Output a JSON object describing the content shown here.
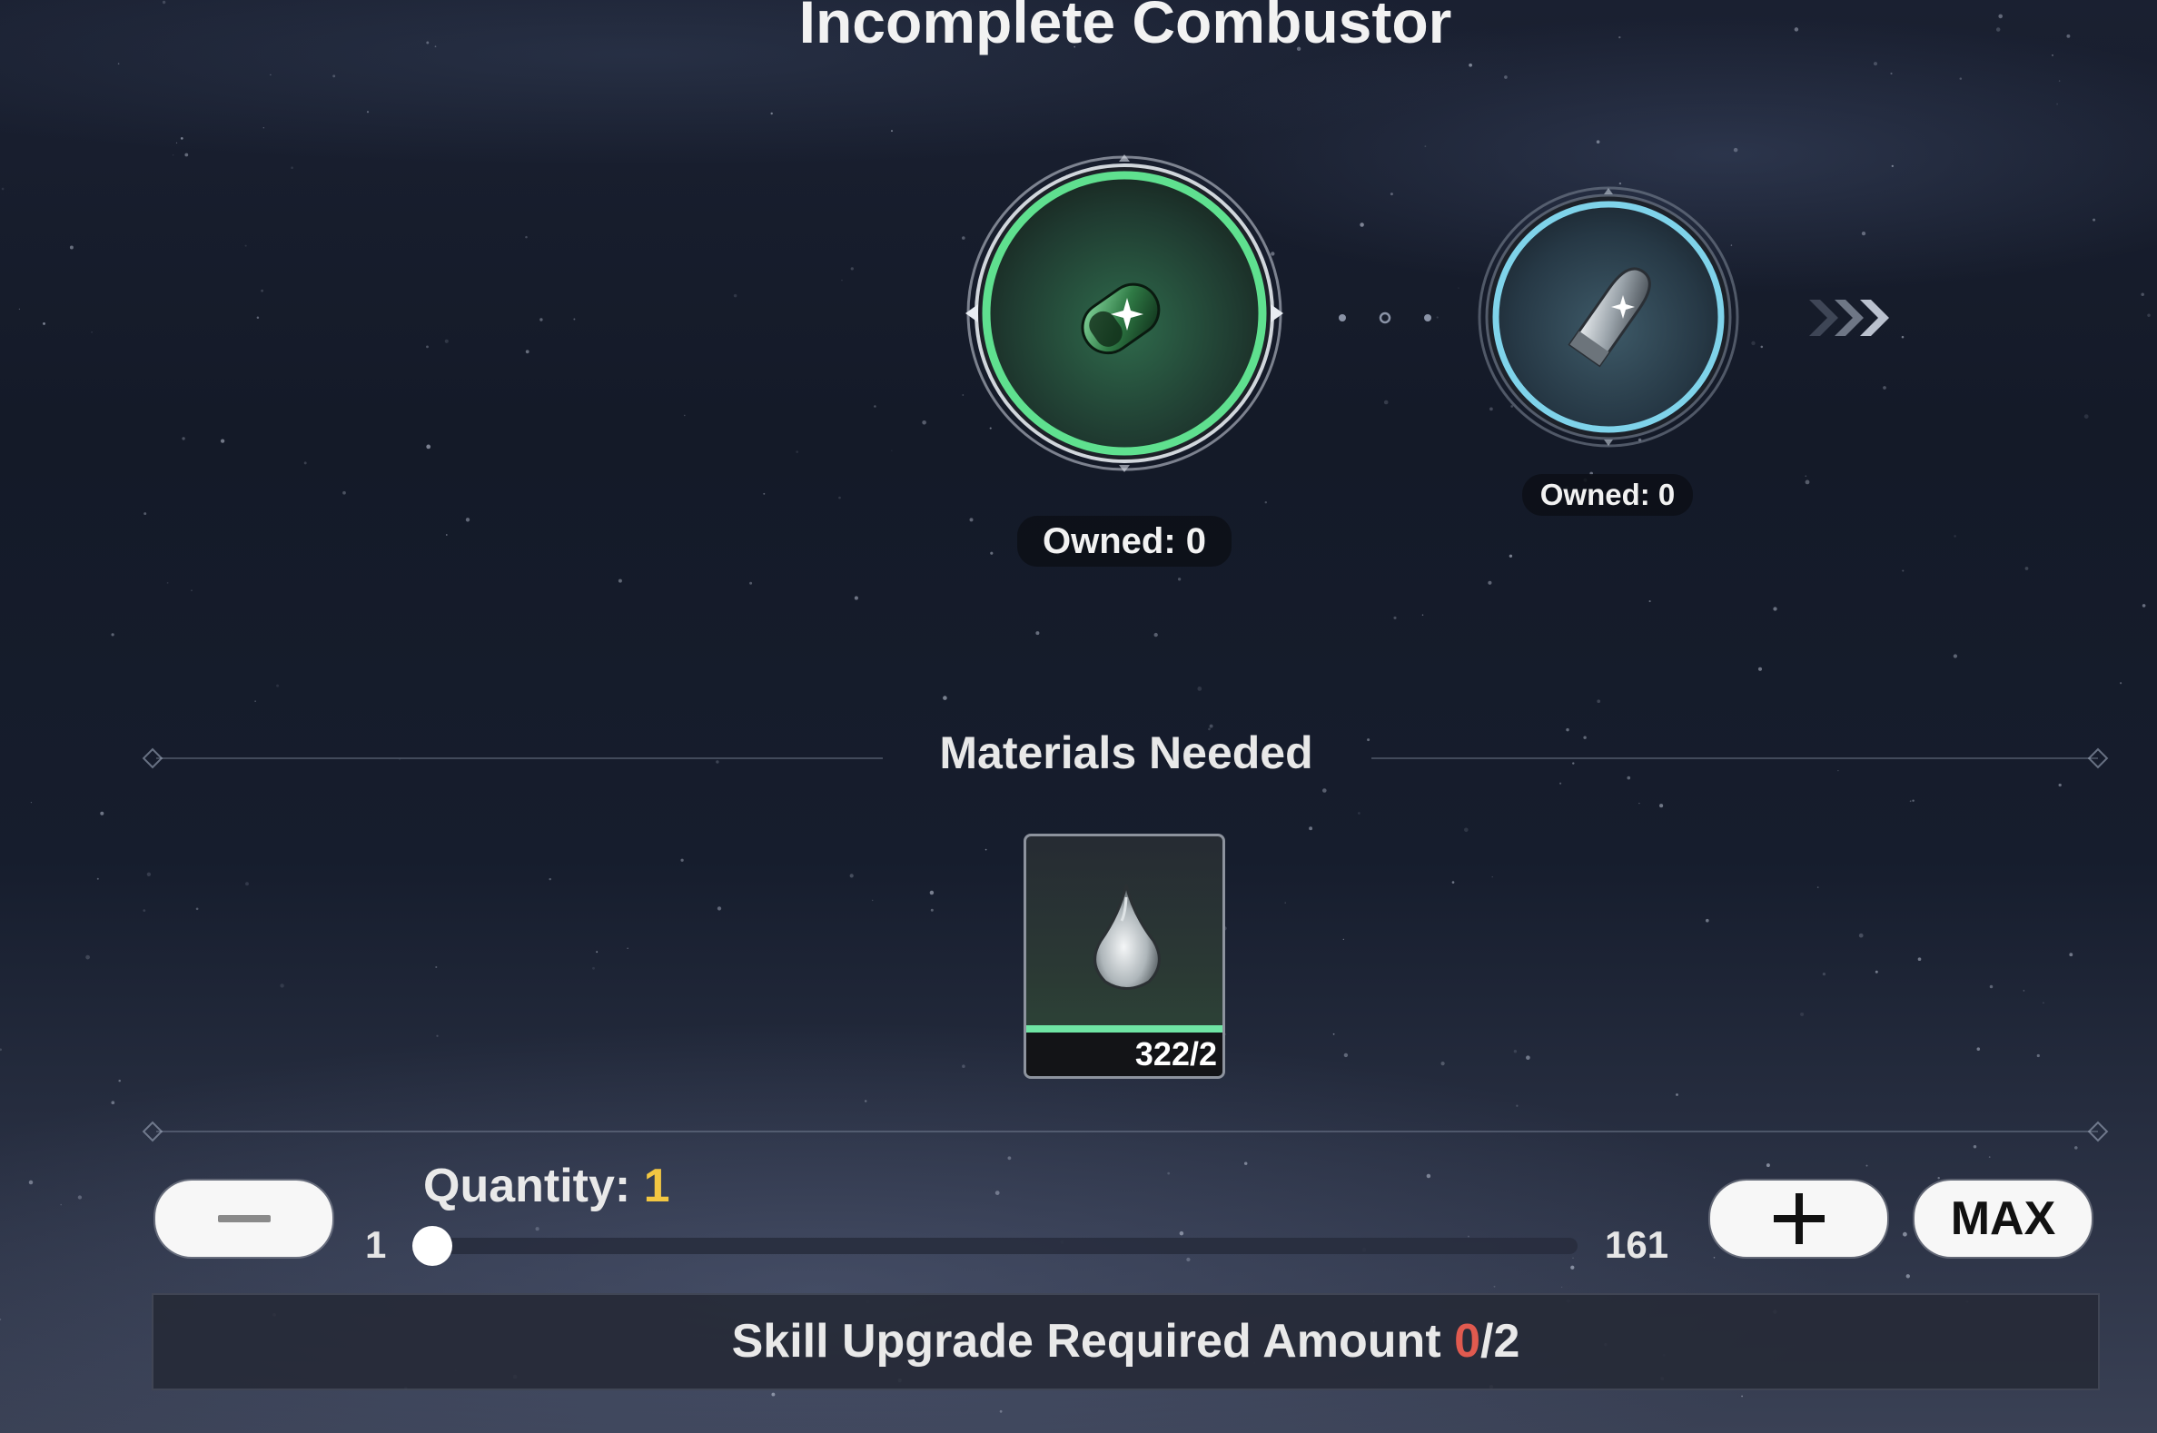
{
  "header": {
    "title": "Incomplete Combustor"
  },
  "upgrade_path": {
    "nodes": [
      {
        "owned_label": "Owned: 0",
        "icon": "green-crystal-shell-icon",
        "rarity_color": "#5fe08f"
      },
      {
        "owned_label": "Owned: 0",
        "icon": "blue-metal-bullet-icon",
        "rarity_color": "#7fd3ea"
      }
    ],
    "next_icon": "chevron-right-triple-icon"
  },
  "materials": {
    "title": "Materials Needed",
    "items": [
      {
        "icon": "clear-droplet-icon",
        "count_label": "322/2",
        "bar_color": "#6fe5a4"
      }
    ]
  },
  "quantity": {
    "label": "Quantity: ",
    "value": "1",
    "min": "1",
    "max": "161",
    "minus_icon": "minus-icon",
    "plus_icon": "plus-icon",
    "max_label": "MAX",
    "slider_fraction": 0.0
  },
  "requirement": {
    "prefix": "Skill Upgrade Required Amount ",
    "current": "0",
    "suffix": "/2",
    "current_color": "#e05a4f"
  }
}
